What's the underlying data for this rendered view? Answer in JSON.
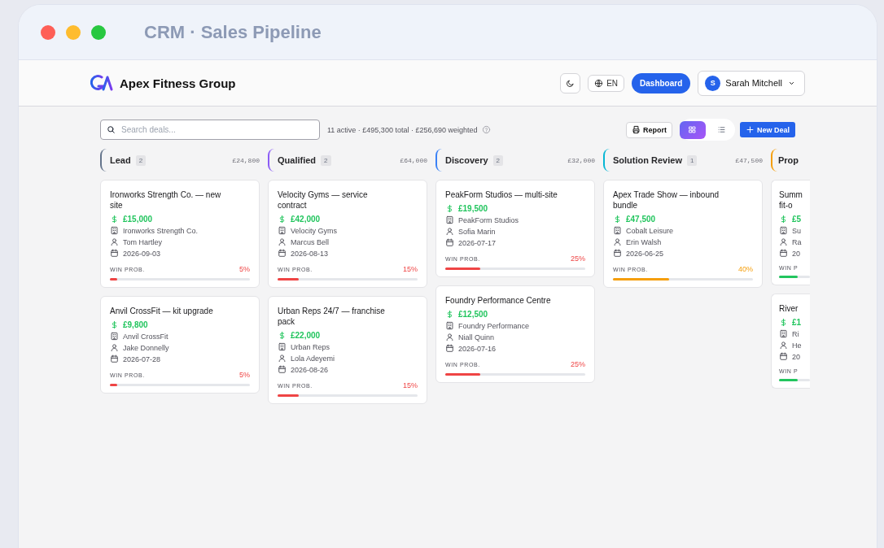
{
  "window": {
    "title": "CRM · Sales Pipeline"
  },
  "header": {
    "brand": "Apex Fitness Group",
    "language": "EN",
    "dashboard": "Dashboard",
    "user": {
      "initial": "S",
      "name": "Sarah Mitchell"
    }
  },
  "toolbar": {
    "search": {
      "placeholder": "Search deals..."
    },
    "summary": "11 active · £495,300 total · £256,690 weighted",
    "report": "Report",
    "views": [
      {
        "kind": "grid",
        "selected": true
      },
      {
        "kind": "list",
        "selected": false
      }
    ],
    "new_deal": "New Deal"
  },
  "columns": [
    {
      "kind": "full",
      "name": "Lead",
      "count": "2",
      "total": "£24,800",
      "color": "#64748b",
      "cards": [
        {
          "title": "Ironworks Strength Co. — new site",
          "amount": "£15,000",
          "company": "Ironworks Strength Co.",
          "owner": "Tom Hartley",
          "date": "2026-09-03",
          "prob_label": "WIN PROB.",
          "prob": "5%",
          "level": 0.05
        },
        {
          "title": "Anvil CrossFit — kit upgrade",
          "amount": "£9,800",
          "company": "Anvil CrossFit",
          "owner": "Jake Donnelly",
          "date": "2026-07-28",
          "prob_label": "WIN PROB.",
          "prob": "5%",
          "level": 0.05
        }
      ]
    },
    {
      "kind": "full",
      "name": "Qualified",
      "count": "2",
      "total": "£64,000",
      "color": "#8b5cf6",
      "cards": [
        {
          "title": "Velocity Gyms — service contract",
          "amount": "£42,000",
          "company": "Velocity Gyms",
          "owner": "Marcus Bell",
          "date": "2026-08-13",
          "prob_label": "WIN PROB.",
          "prob": "15%",
          "level": 0.15
        },
        {
          "title": "Urban Reps 24/7 — franchise pack",
          "amount": "£22,000",
          "company": "Urban Reps",
          "owner": "Lola Adeyemi",
          "date": "2026-08-26",
          "prob_label": "WIN PROB.",
          "prob": "15%",
          "level": 0.15
        }
      ]
    },
    {
      "kind": "full",
      "name": "Discovery",
      "count": "2",
      "total": "£32,000",
      "color": "#3b82f6",
      "cards": [
        {
          "title": "PeakForm Studios — multi-site",
          "amount": "£19,500",
          "company": "PeakForm Studios",
          "owner": "Sofia Marin",
          "date": "2026-07-17",
          "prob_label": "WIN PROB.",
          "prob": "25%",
          "level": 0.25
        },
        {
          "title": "Foundry Performance Centre",
          "amount": "£12,500",
          "company": "Foundry Performance",
          "owner": "Niall Quinn",
          "date": "2026-07-16",
          "prob_label": "WIN PROB.",
          "prob": "25%",
          "level": 0.25
        }
      ]
    },
    {
      "kind": "full",
      "name": "Solution Review",
      "count": "1",
      "total": "£47,500",
      "color": "#06b6d4",
      "cards": [
        {
          "title": "Apex Trade Show — inbound bundle",
          "amount": "£47,500",
          "company": "Cobalt Leisure",
          "owner": "Erin Walsh",
          "date": "2026-06-25",
          "prob_label": "WIN PROB.",
          "prob": "40%",
          "level": 0.4
        }
      ]
    },
    {
      "kind": "partial",
      "name": "Prop",
      "color": "#f59e0b",
      "cards": [
        {
          "title": "Summ fit-o",
          "amount": "£5",
          "company": "Su",
          "owner": "Ra",
          "date": "20",
          "prob_label": "WIN P",
          "level": 0.6
        },
        {
          "title": "River",
          "amount": "£1",
          "company": "Ri",
          "owner": "He",
          "date": "20",
          "prob_label": "WIN P",
          "level": 0.6
        }
      ]
    }
  ]
}
